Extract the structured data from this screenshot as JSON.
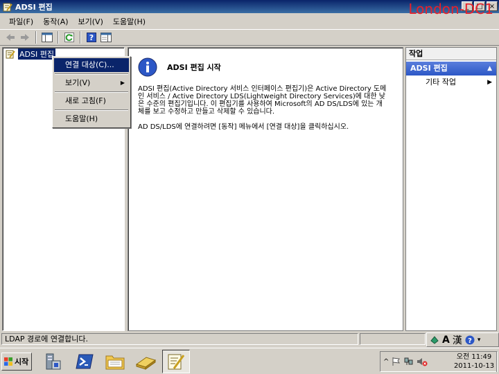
{
  "window": {
    "title": "ADSI 편집",
    "server_label": "London-DC1",
    "buttons": [
      "_",
      "□",
      "×"
    ]
  },
  "menubar": {
    "items": [
      "파일(F)",
      "동작(A)",
      "보기(V)",
      "도움말(H)"
    ]
  },
  "toolbar": {
    "icons": [
      "back-icon",
      "forward-icon",
      "show-hide-tree-icon",
      "refresh-icon",
      "help-icon",
      "show-hide-action-pane-icon"
    ]
  },
  "tree": {
    "root_label": "ADSI 편집"
  },
  "context_menu": {
    "items": [
      "연결 대상(C)...",
      "보기(V)",
      "새로 고침(F)",
      "도움말(H)"
    ]
  },
  "content": {
    "heading": "ADSI 편집 시작",
    "paragraph1": "ADSI 편집(Active Directory 서비스 인터페이스 편집기)은 Active Directory 도메인 서비스 / Active Directory LDS(Lightweight Directory Services)에 대한 낮은 수준의 편집기입니다. 이 편집기를 사용하여 Microsoft의 AD DS/LDS에 있는 개체를 보고 수정하고 만들고 삭제할 수 있습니다.",
    "paragraph2": "AD DS/LDS에 연결하려면 [동작] 메뉴에서 [연결 대상]을 클릭하십시오."
  },
  "actions": {
    "title": "작업",
    "section": "ADSI 편집",
    "more": "기타 작업"
  },
  "status": {
    "text": "LDAP 경로에 연결합니다."
  },
  "langbar": {
    "mode": "A",
    "hanja": "漢"
  },
  "taskbar": {
    "start_label": "시작"
  },
  "clock": {
    "time": "오전 11:49",
    "date": "2011-10-13"
  },
  "colors": {
    "titlebar": "#0a246a",
    "server_label": "#e8202a",
    "selection": "#0a246a",
    "actions_header": "#2c57c6"
  }
}
